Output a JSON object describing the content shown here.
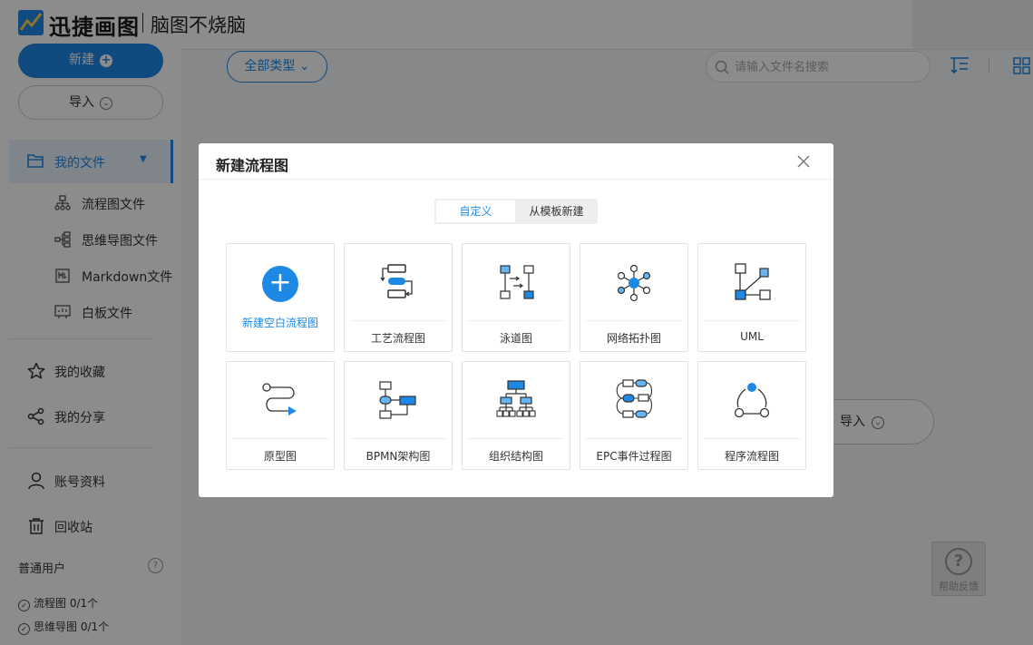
{
  "header": {
    "brand": "迅捷画图",
    "slogan": "脑图不烧脑"
  },
  "sidebar": {
    "new_button": "新建",
    "import_button": "导入",
    "my_files": "我的文件",
    "sub_items": [
      {
        "label": "流程图文件",
        "icon": "flowchart-icon"
      },
      {
        "label": "思维导图文件",
        "icon": "mindmap-icon"
      },
      {
        "label": "Markdown文件",
        "icon": "markdown-icon"
      },
      {
        "label": "白板文件",
        "icon": "whiteboard-icon"
      }
    ],
    "favorites": "我的收藏",
    "shares": "我的分享",
    "account": "账号资料",
    "trash": "回收站",
    "user_type": "普通用户",
    "quota": [
      {
        "label": "流程图 0/1个"
      },
      {
        "label": "思维导图 0/1个"
      }
    ]
  },
  "toolbar": {
    "all_types": "全部类型",
    "search_placeholder": "请输入文件名搜索"
  },
  "background": {
    "import_label": "导入",
    "help_label": "帮助反馈"
  },
  "modal": {
    "title": "新建流程图",
    "tabs": [
      "自定义",
      "从模板新建"
    ],
    "blank_label": "新建空白流程图",
    "templates": [
      {
        "label": "工艺流程图",
        "icon": "process-flow-icon"
      },
      {
        "label": "泳道图",
        "icon": "swimlane-icon"
      },
      {
        "label": "网络拓扑图",
        "icon": "network-topology-icon"
      },
      {
        "label": "UML",
        "icon": "uml-icon"
      },
      {
        "label": "原型图",
        "icon": "prototype-icon"
      },
      {
        "label": "BPMN架构图",
        "icon": "bpmn-icon"
      },
      {
        "label": "组织结构图",
        "icon": "org-chart-icon"
      },
      {
        "label": "EPC事件过程图",
        "icon": "epc-icon"
      },
      {
        "label": "程序流程图",
        "icon": "program-flow-icon"
      }
    ]
  },
  "colors": {
    "accent": "#1e88e5",
    "icon_light": "#64b5f6"
  }
}
